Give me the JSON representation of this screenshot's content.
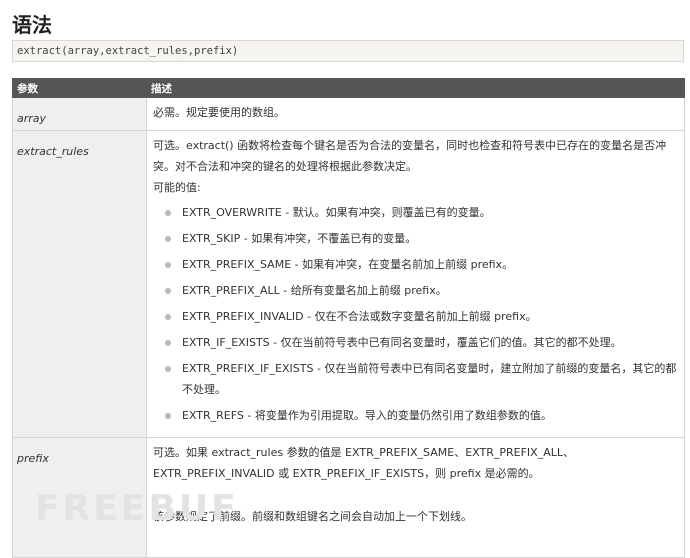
{
  "heading": "语法",
  "syntax": "extract(array,extract_rules,prefix)",
  "table": {
    "col_param": "参数",
    "col_desc": "描述",
    "array": {
      "name": "array",
      "desc": "必需。规定要使用的数组。"
    },
    "extract_rules": {
      "name": "extract_rules",
      "desc": "可选。extract() 函数将检查每个键名是否为合法的变量名，同时也检查和符号表中已存在的变量名是否冲突。对不合法和冲突的键名的处理将根据此参数决定。",
      "possible_label": "可能的值:",
      "values": [
        "EXTR_OVERWRITE - 默认。如果有冲突，则覆盖已有的变量。",
        "EXTR_SKIP - 如果有冲突，不覆盖已有的变量。",
        "EXTR_PREFIX_SAME - 如果有冲突，在变量名前加上前缀 prefix。",
        "EXTR_PREFIX_ALL - 给所有变量名加上前缀 prefix。",
        "EXTR_PREFIX_INVALID - 仅在不合法或数字变量名前加上前缀 prefix。",
        "EXTR_IF_EXISTS - 仅在当前符号表中已有同名变量时，覆盖它们的值。其它的都不处理。",
        "EXTR_PREFIX_IF_EXISTS - 仅在当前符号表中已有同名变量时，建立附加了前缀的变量名，其它的都不处理。",
        "EXTR_REFS - 将变量作为引用提取。导入的变量仍然引用了数组参数的值。"
      ]
    },
    "prefix": {
      "name": "prefix",
      "desc1": "可选。如果 extract_rules 参数的值是 EXTR_PREFIX_SAME、EXTR_PREFIX_ALL、 EXTR_PREFIX_INVALID 或 EXTR_PREFIX_IF_EXISTS，则 prefix 是必需的。",
      "desc2": "该参数规定了前缀。前缀和数组键名之间会自动加上一个下划线。"
    }
  },
  "watermark": "FREEBUF"
}
